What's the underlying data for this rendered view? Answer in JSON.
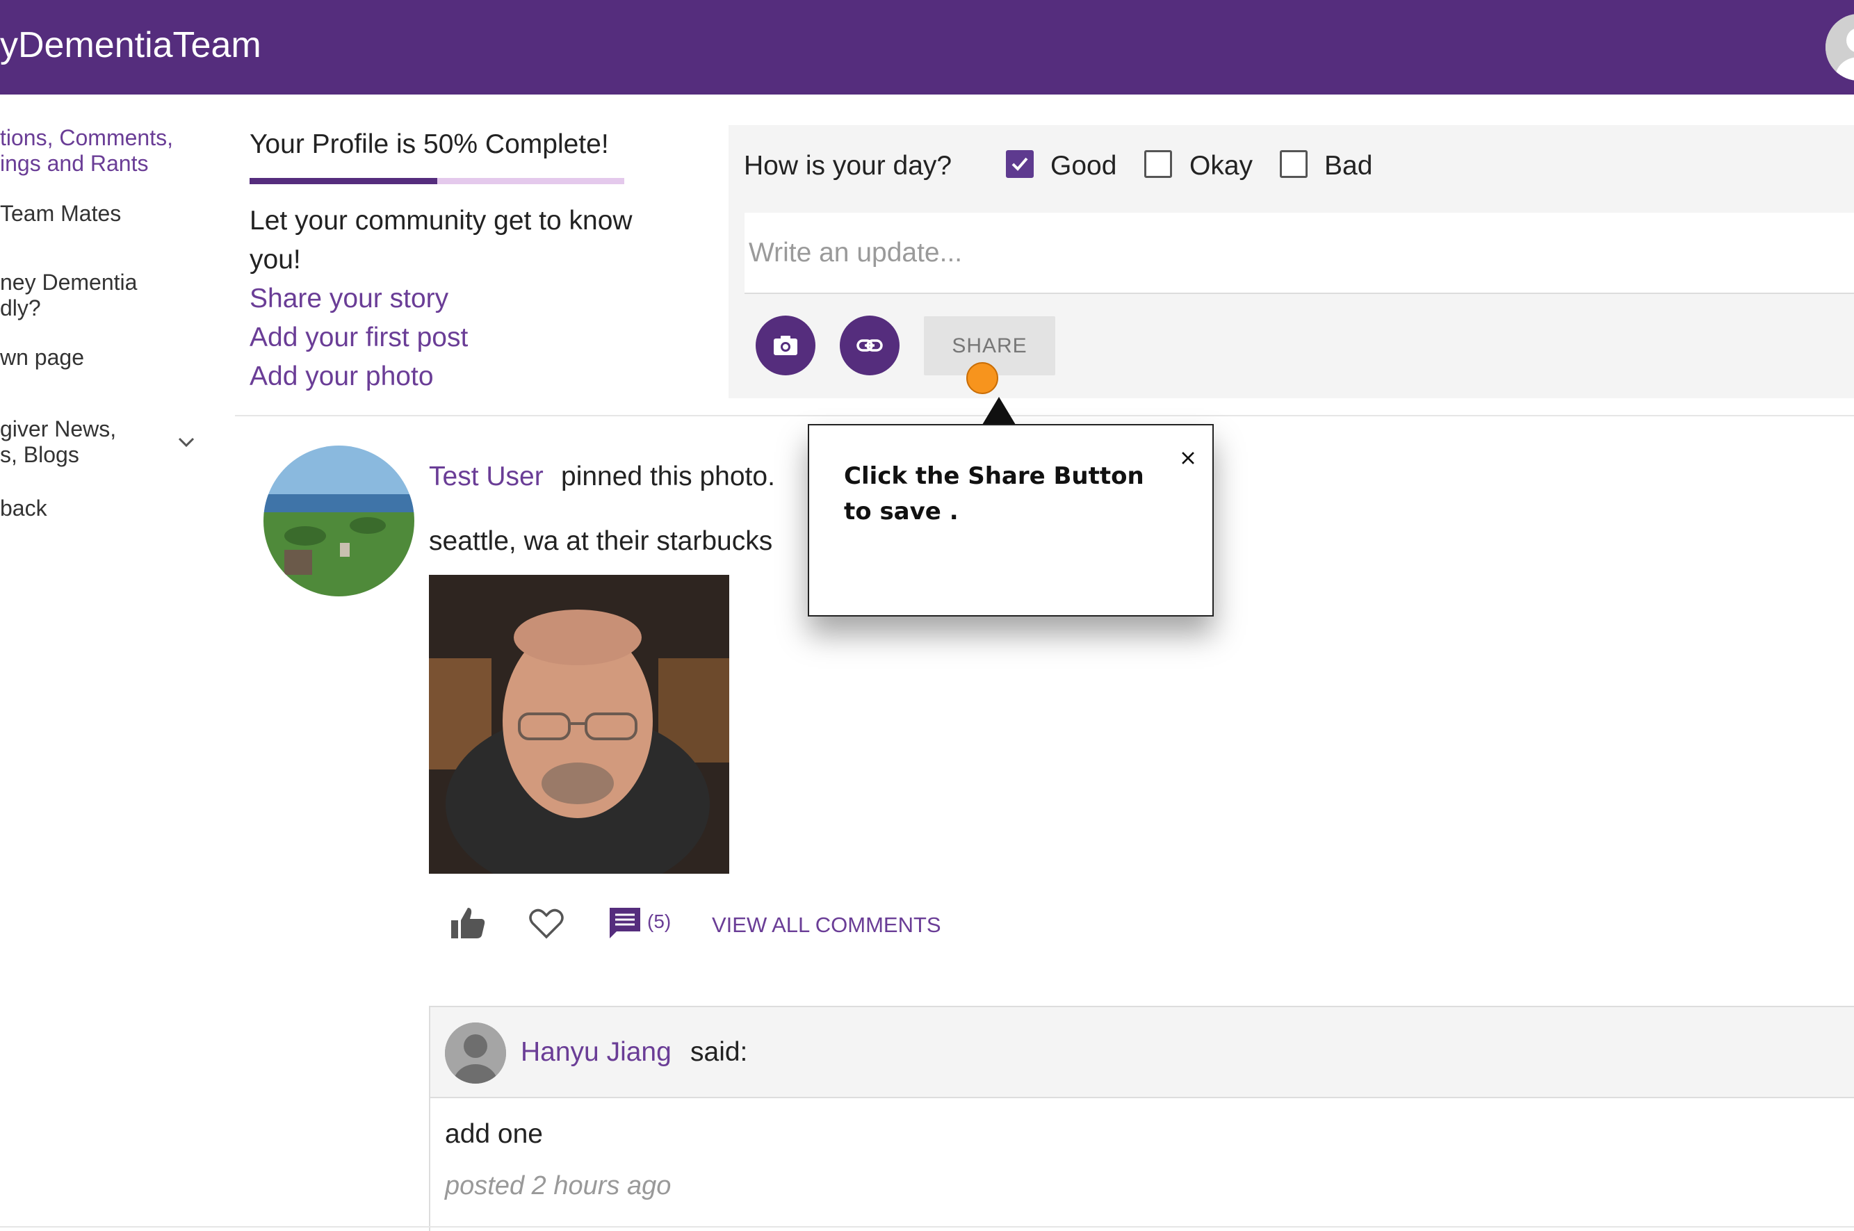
{
  "header": {
    "app_title": "yDementiaTeam"
  },
  "sidebar": {
    "items": [
      {
        "line1": "tions, Comments,",
        "line2": "ings and Rants"
      },
      {
        "line1": "Team Mates"
      },
      {
        "line1": "ney Dementia",
        "line2": "dly?"
      },
      {
        "line1": "wn page"
      },
      {
        "line1": "giver News,",
        "line2": "s, Blogs"
      },
      {
        "line1": "back"
      }
    ]
  },
  "profile": {
    "title": "Your Profile is 50% Complete!",
    "progress_percent": 50,
    "intro": "Let your community get to know you!",
    "links": [
      "Share your story",
      "Add your first post",
      "Add your photo"
    ]
  },
  "status": {
    "question": "How is your day?",
    "options": [
      {
        "label": "Good",
        "checked": true
      },
      {
        "label": "Okay",
        "checked": false
      },
      {
        "label": "Bad",
        "checked": false
      }
    ],
    "update_placeholder": "Write an update...",
    "share_label": "SHARE"
  },
  "tooltip": {
    "text": "Click the Share Button to save ."
  },
  "post": {
    "author": "Test User",
    "action": "pinned this photo.",
    "text": "seattle, wa at their starbucks",
    "comment_count": "(5)",
    "view_all_label": "VIEW ALL COMMENTS"
  },
  "comment": {
    "author": "Hanyu Jiang",
    "said": "said:",
    "text": "add one",
    "time": "posted 2 hours ago"
  },
  "colors": {
    "brand": "#552d7d",
    "link": "#6a3d96",
    "tap_marker": "#f7941d"
  }
}
